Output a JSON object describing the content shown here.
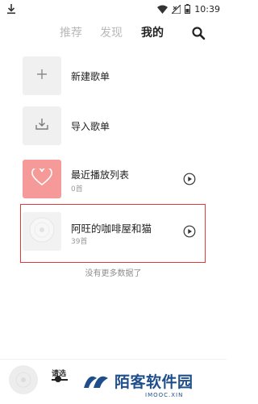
{
  "status_bar": {
    "time": "10:39",
    "icons": [
      "download-icon",
      "wifi-icon",
      "no-signal-icon",
      "battery-icon"
    ]
  },
  "top_tabs": {
    "items": [
      {
        "label": "推荐",
        "active": false
      },
      {
        "label": "发现",
        "active": false
      },
      {
        "label": "我的",
        "active": true
      }
    ]
  },
  "actions": {
    "new_playlist": "新建歌单",
    "import_playlist": "导入歌单"
  },
  "playlists": [
    {
      "name": "最近播放列表",
      "count": "0首"
    },
    {
      "name": "阿旺的咖啡屋和猫",
      "count": "39首"
    }
  ],
  "list_end_text": "没有更多数据了",
  "player": {
    "title_partial": "请选"
  },
  "watermark": {
    "brand": "陌客软件园",
    "url": "IMOOC.XIN"
  },
  "colors": {
    "accent_pink": "#f59a99",
    "highlight_red": "#e03a3a",
    "watermark_blue": "#1f4f8a"
  }
}
